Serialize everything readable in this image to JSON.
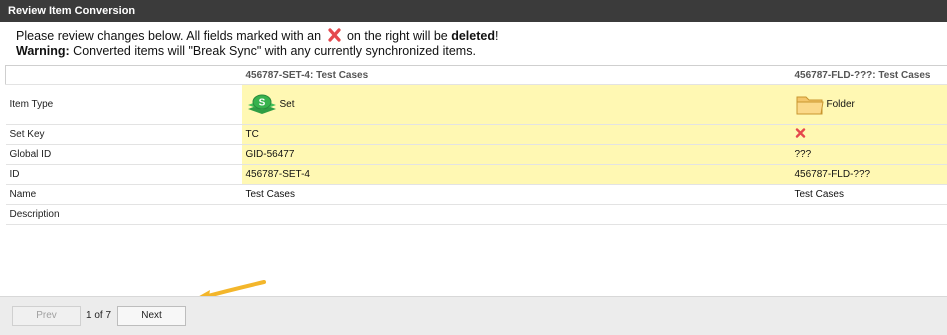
{
  "window": {
    "title": "Review Item Conversion"
  },
  "intro": {
    "line1_before": "Please review changes below.  All fields marked with an ",
    "line1_after": " on the right will be ",
    "line1_bold": "deleted",
    "line1_end": "!",
    "warning_label": "Warning:",
    "warning_text": " Converted items will \"Break Sync\" with any currently synchronized items."
  },
  "table": {
    "headers": [
      "",
      "456787-SET-4: Test Cases",
      "456787-FLD-???: Test Cases"
    ],
    "rows": [
      {
        "label": "Item Type",
        "left": "Set",
        "right": "Folder"
      },
      {
        "label": "Set Key",
        "left": "TC",
        "right": ""
      },
      {
        "label": "Global ID",
        "left": "GID-56477",
        "right": "???"
      },
      {
        "label": "ID",
        "left": "456787-SET-4",
        "right": "456787-FLD-???"
      },
      {
        "label": "Name",
        "left": "Test Cases",
        "right": "Test Cases"
      },
      {
        "label": "Description",
        "left": "",
        "right": ""
      }
    ],
    "set_icon_letter": "S"
  },
  "pager": {
    "prev_label": "Prev",
    "page_info": "1 of 7",
    "next_label": "Next"
  },
  "colors": {
    "titlebar": "#3b3b3b",
    "highlight": "#fff8b3",
    "delete_x": "#e5484d",
    "arrow": "#f3b62b"
  },
  "icons": {
    "delete": "delete-x-icon",
    "set": "set-stack-icon",
    "folder": "folder-icon",
    "arrow": "annotation-arrow"
  }
}
